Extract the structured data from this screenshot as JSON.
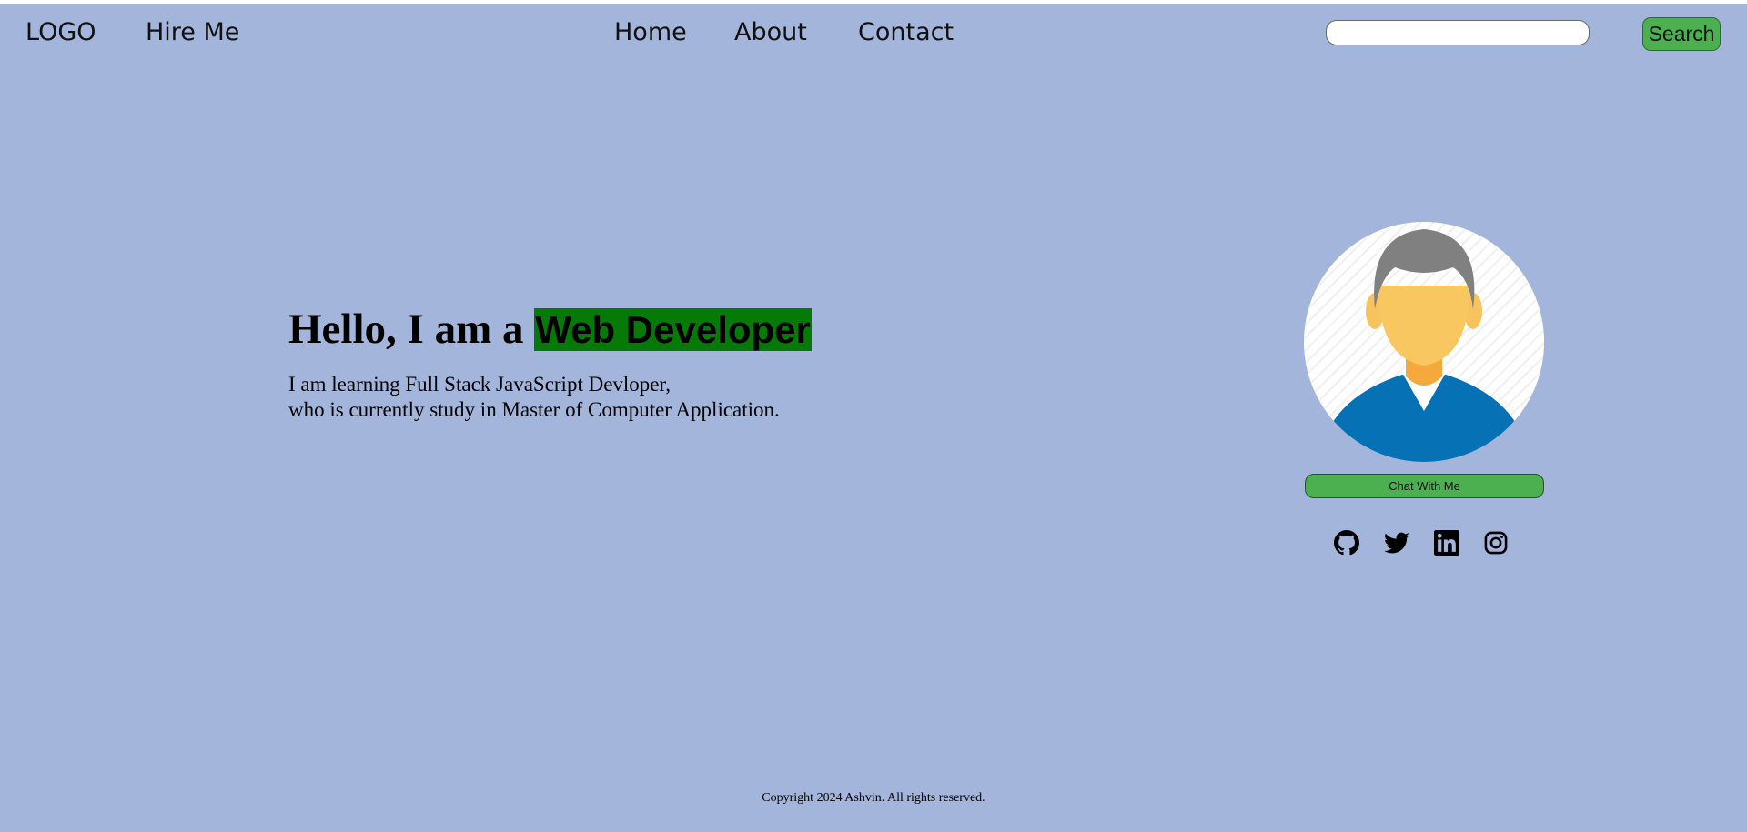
{
  "header": {
    "logo": "LOGO",
    "hire_me": "Hire Me",
    "nav": [
      {
        "label": "Home"
      },
      {
        "label": "About"
      },
      {
        "label": "Contact"
      }
    ],
    "search": {
      "value": "",
      "placeholder": "",
      "button_label": "Search"
    }
  },
  "hero": {
    "heading_prefix": "Hello, I am a ",
    "heading_highlight": "Web Developer",
    "desc_line1": "I am learning Full Stack JavaScript Devloper,",
    "desc_line2": "who is currently study in Master of Computer Application."
  },
  "profile": {
    "avatar_icon": "male-user-avatar",
    "chat_button": "Chat With Me",
    "social_icons": [
      "github-icon",
      "twitter-icon",
      "linkedin-icon",
      "instagram-icon"
    ]
  },
  "footer": {
    "copyright": "Copyright 2024 Ashvin. All rights reserved."
  },
  "colors": {
    "page_background": "#a3b5da",
    "accent_green": "#4caf50",
    "highlight_green": "#067a06"
  }
}
